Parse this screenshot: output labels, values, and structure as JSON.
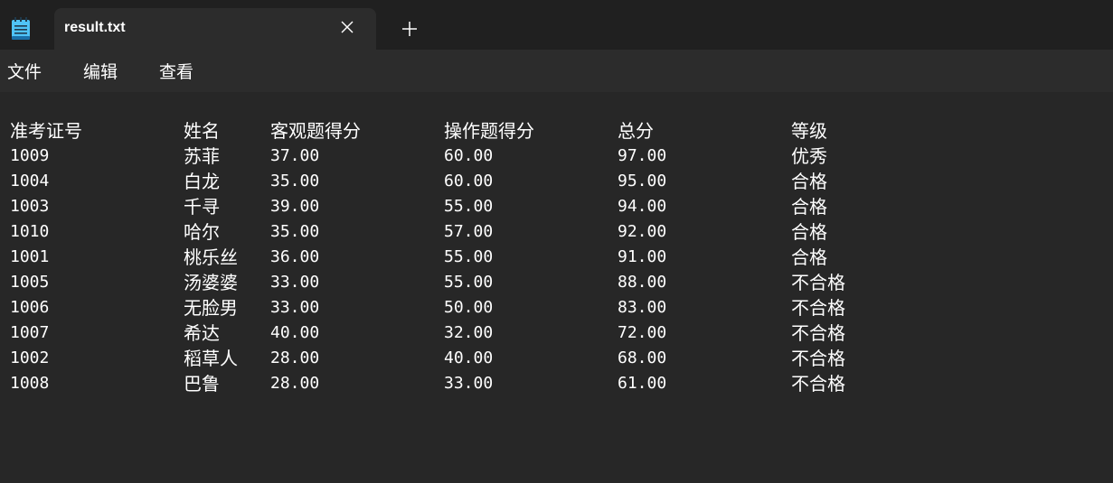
{
  "window": {
    "tab_title": "result.txt",
    "app_icon": "notepad-icon",
    "close_icon": "close-icon",
    "new_tab_icon": "plus-icon"
  },
  "menu": {
    "items": [
      "文件",
      "编辑",
      "查看"
    ]
  },
  "table": {
    "headers": [
      "准考证号",
      "姓名",
      "客观题得分",
      "操作题得分",
      "总分",
      "等级"
    ],
    "rows": [
      [
        "1009",
        "苏菲",
        "37.00",
        "60.00",
        "97.00",
        "优秀"
      ],
      [
        "1004",
        "白龙",
        "35.00",
        "60.00",
        "95.00",
        "合格"
      ],
      [
        "1003",
        "千寻",
        "39.00",
        "55.00",
        "94.00",
        "合格"
      ],
      [
        "1010",
        "哈尔",
        "35.00",
        "57.00",
        "92.00",
        "合格"
      ],
      [
        "1001",
        "桃乐丝",
        "36.00",
        "55.00",
        "91.00",
        "合格"
      ],
      [
        "1005",
        "汤婆婆",
        "33.00",
        "55.00",
        "88.00",
        "不合格"
      ],
      [
        "1006",
        "无脸男",
        "33.00",
        "50.00",
        "83.00",
        "不合格"
      ],
      [
        "1007",
        "希达",
        "40.00",
        "32.00",
        "72.00",
        "不合格"
      ],
      [
        "1002",
        "稻草人",
        "28.00",
        "40.00",
        "68.00",
        "不合格"
      ],
      [
        "1008",
        "巴鲁",
        "28.00",
        "33.00",
        "61.00",
        "不合格"
      ]
    ]
  },
  "colors": {
    "titlebar": "#202020",
    "tab": "#2c2c2c",
    "menubar": "#2c2c2c",
    "editor": "#272727",
    "text": "#ffffff",
    "icon_accent": "#4fc3f7"
  }
}
